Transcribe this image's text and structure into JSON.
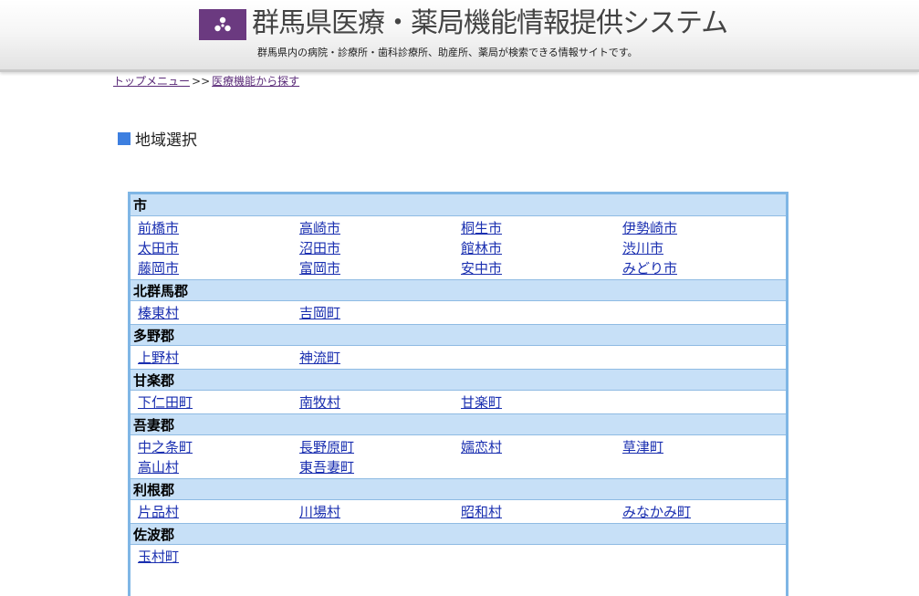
{
  "header": {
    "title": "群馬県医療・薬局機能情報提供システム",
    "subtitle": "群馬県内の病院・診療所・歯科診療所、助産所、薬局が検索できる情報サイトです。",
    "logo_icon": "gunma-prefecture-emblem-icon",
    "logo_color": "#6b3a80"
  },
  "breadcrumb": {
    "top_menu": "トップメニュー",
    "separator": ">>",
    "current": "医療機能から探す"
  },
  "page": {
    "title": "地域選択",
    "title_marker_color": "#3d7fe0"
  },
  "regions": [
    {
      "name": "市",
      "items": [
        "前橋市",
        "高崎市",
        "桐生市",
        "伊勢崎市",
        "太田市",
        "沼田市",
        "館林市",
        "渋川市",
        "藤岡市",
        "富岡市",
        "安中市",
        "みどり市"
      ]
    },
    {
      "name": "北群馬郡",
      "items": [
        "榛東村",
        "吉岡町"
      ]
    },
    {
      "name": "多野郡",
      "items": [
        "上野村",
        "神流町"
      ]
    },
    {
      "name": "甘楽郡",
      "items": [
        "下仁田町",
        "南牧村",
        "甘楽町"
      ]
    },
    {
      "name": "吾妻郡",
      "items": [
        "中之条町",
        "長野原町",
        "嬬恋村",
        "草津町",
        "高山村",
        "東吾妻町"
      ]
    },
    {
      "name": "利根郡",
      "items": [
        "片品村",
        "川場村",
        "昭和村",
        "みなかみ町"
      ]
    },
    {
      "name": "佐波郡",
      "items": [
        "玉村町"
      ]
    }
  ]
}
